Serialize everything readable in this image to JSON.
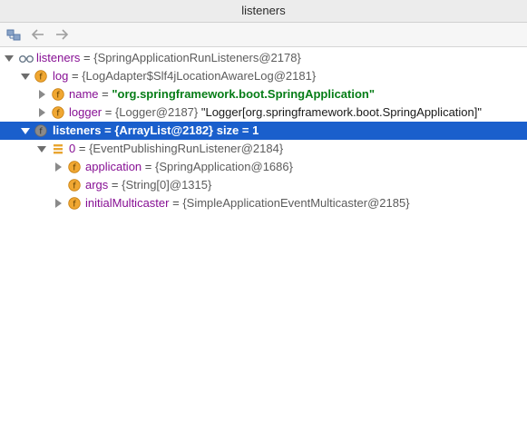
{
  "window": {
    "title": "listeners"
  },
  "toolbar": {
    "buttons": [
      "object-view-icon",
      "back-arrow-icon",
      "forward-arrow-icon"
    ]
  },
  "tree": {
    "root": {
      "name": "listeners",
      "eq": " = ",
      "value": "{SpringApplicationRunListeners@2178}"
    },
    "log": {
      "name": "log",
      "eq": " = ",
      "value": "{LogAdapter$Slf4jLocationAwareLog@2181}"
    },
    "log_name": {
      "name": "name",
      "eq": " = ",
      "value": "\"org.springframework.boot.SpringApplication\""
    },
    "log_logger": {
      "name": "logger",
      "eq": " = ",
      "value": "{Logger@2187}",
      "extra": " \"Logger[org.springframework.boot.SpringApplication]\""
    },
    "listeners": {
      "name": "listeners",
      "eq": " = ",
      "value": "{ArrayList@2182}  size = 1"
    },
    "item0": {
      "name": "0",
      "eq": " = ",
      "value": "{EventPublishingRunListener@2184}"
    },
    "application": {
      "name": "application",
      "eq": " = ",
      "value": "{SpringApplication@1686}"
    },
    "args": {
      "name": "args",
      "eq": " = ",
      "value": "{String[0]@1315}"
    },
    "multicaster": {
      "name": "initialMulticaster",
      "eq": " = ",
      "value": "{SimpleApplicationEventMulticaster@2185}"
    }
  },
  "colors": {
    "selection": "#1a5fcc",
    "field_name": "#871094",
    "string_value": "#067d17",
    "field_icon": "#f0a732"
  }
}
